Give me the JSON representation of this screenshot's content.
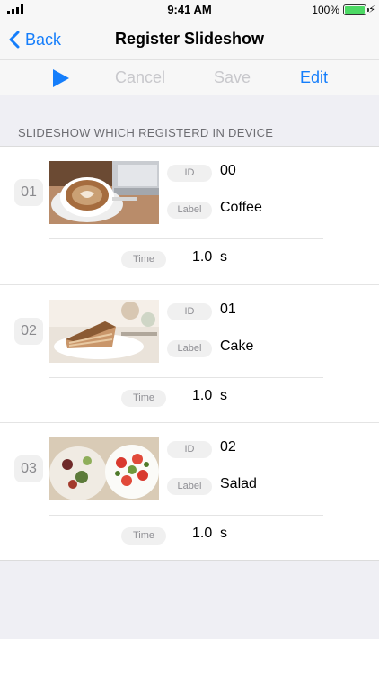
{
  "status_bar": {
    "time": "9:41 AM",
    "battery": "100%"
  },
  "nav": {
    "back_label": "Back",
    "title": "Register Slideshow"
  },
  "toolbar": {
    "cancel_label": "Cancel",
    "save_label": "Save",
    "edit_label": "Edit"
  },
  "section_header": "SLIDESHOW WHICH REGISTERD IN DEVICE",
  "field_labels": {
    "id": "ID",
    "label": "Label",
    "time": "Time"
  },
  "slides": [
    {
      "index": "01",
      "id": "00",
      "label": "Coffee",
      "time": "1.0",
      "unit": "s"
    },
    {
      "index": "02",
      "id": "01",
      "label": "Cake",
      "time": "1.0",
      "unit": "s"
    },
    {
      "index": "03",
      "id": "02",
      "label": "Salad",
      "time": "1.0",
      "unit": "s"
    }
  ],
  "colors": {
    "accent": "#157efb",
    "disabled": "#c8c8cc",
    "background": "#efeff4"
  }
}
